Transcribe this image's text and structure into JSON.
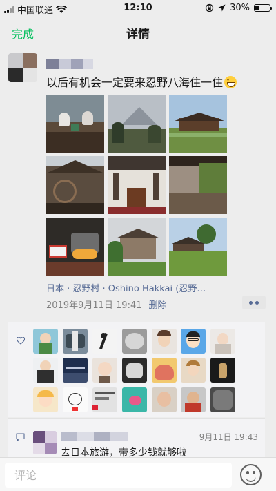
{
  "status_bar": {
    "carrier": "中国联通",
    "time": "12:10",
    "battery": "30%",
    "battery_fraction": 0.3
  },
  "nav": {
    "done_label": "完成",
    "title": "详情"
  },
  "post": {
    "text": "以后有机会一定要来忍野八海住一住",
    "location": "日本 · 忍野村 · Oshino Hakkai (忍野…",
    "time": "2019年9月11日 19:41",
    "delete_label": "删除"
  },
  "comment": {
    "time": "9月11日 19:43",
    "text": "去日本旅游，带多少钱就够啦"
  },
  "input": {
    "placeholder": "评论"
  },
  "colors": {
    "accent": "#07c160",
    "link": "#576b95",
    "meta": "#7f7f7f"
  },
  "icons": [
    "wifi-icon",
    "lock-rotation-icon",
    "location-arrow-icon",
    "battery-icon",
    "smile-emoji-icon",
    "more-dots-icon",
    "heart-icon",
    "comment-icon",
    "emoji-button-icon"
  ]
}
